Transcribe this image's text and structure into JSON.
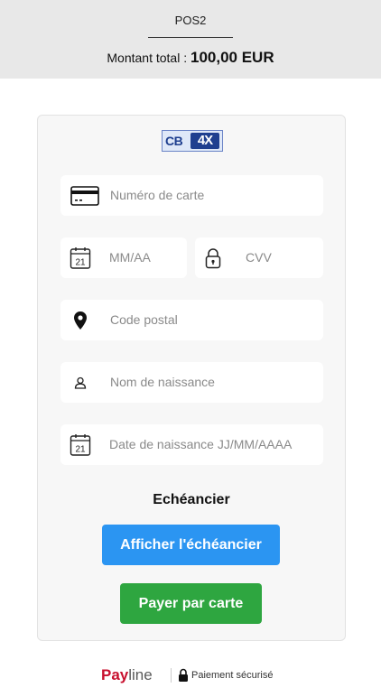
{
  "header": {
    "merchant_name": "POS2",
    "amount_label": "Montant total :",
    "amount_value": "100,00 EUR"
  },
  "logo": {
    "cb_text": "CB",
    "brand_text": "4X"
  },
  "form": {
    "card_number": {
      "placeholder": "Numéro de carte",
      "icon": "credit-card-icon"
    },
    "expiry": {
      "placeholder": "MM/AA",
      "icon": "calendar-icon",
      "icon_text": "21"
    },
    "cvv": {
      "placeholder": "CVV",
      "icon": "padlock-icon"
    },
    "postal_code": {
      "placeholder": "Code postal",
      "icon": "location-pin-icon"
    },
    "birth_name": {
      "placeholder": "Nom de naissance",
      "icon": "user-icon"
    },
    "birth_date": {
      "placeholder": "Date de naissance JJ/MM/AAAA",
      "icon": "calendar-icon",
      "icon_text": "21"
    }
  },
  "schedule": {
    "title": "Echéancier",
    "show_button": "Afficher l'échéancier"
  },
  "pay_button": "Payer par carte",
  "footer": {
    "brand_pay": "Pay",
    "brand_line": "line",
    "secure_text": "Paiement sécurisé"
  },
  "colors": {
    "header_bg": "#e8e8e8",
    "card_bg": "#f7f7f7",
    "schedule_button": "#2b95f2",
    "pay_button": "#2ea640",
    "brand_red": "#c8102e"
  }
}
